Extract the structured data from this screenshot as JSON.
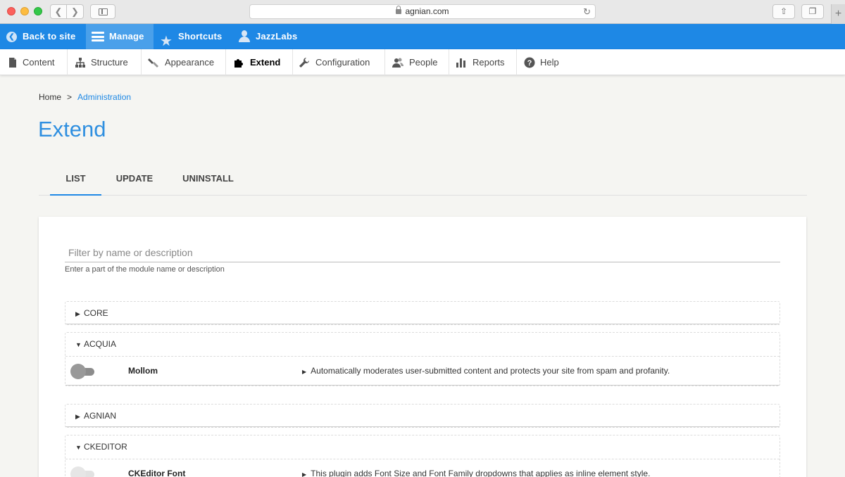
{
  "browser": {
    "url": "agnian.com"
  },
  "toolbar": {
    "back_label": "Back to site",
    "manage_label": "Manage",
    "shortcuts_label": "Shortcuts",
    "user_label": "JazzLabs",
    "color": "#1e88e5"
  },
  "tray": {
    "content": "Content",
    "structure": "Structure",
    "appearance": "Appearance",
    "extend": "Extend",
    "configuration": "Configuration",
    "people": "People",
    "reports": "Reports",
    "help": "Help"
  },
  "breadcrumb": {
    "home": "Home",
    "separator": ">",
    "current": "Administration"
  },
  "page": {
    "title": "Extend"
  },
  "tabs": {
    "list": "LIST",
    "update": "UPDATE",
    "uninstall": "UNINSTALL"
  },
  "filter": {
    "placeholder": "Filter by name or description",
    "value": "",
    "help": "Enter a part of the module name or description"
  },
  "packages": {
    "core": {
      "label": "CORE",
      "expanded": false
    },
    "acquia": {
      "label": "ACQUIA",
      "expanded": true,
      "modules": [
        {
          "name": "Mollom",
          "enabled": false,
          "description": "Automatically moderates user-submitted content and protects your site from spam and profanity."
        }
      ]
    },
    "agnian": {
      "label": "AGNIAN",
      "expanded": false
    },
    "ckeditor": {
      "label": "CKEDITOR",
      "expanded": true,
      "modules": [
        {
          "name": "CKEditor Font",
          "enabled": false,
          "description": "This plugin adds Font Size and Font Family dropdowns that applies as inline element style."
        }
      ]
    }
  },
  "icons": {
    "collapsed": "▶",
    "expanded": "▼"
  }
}
